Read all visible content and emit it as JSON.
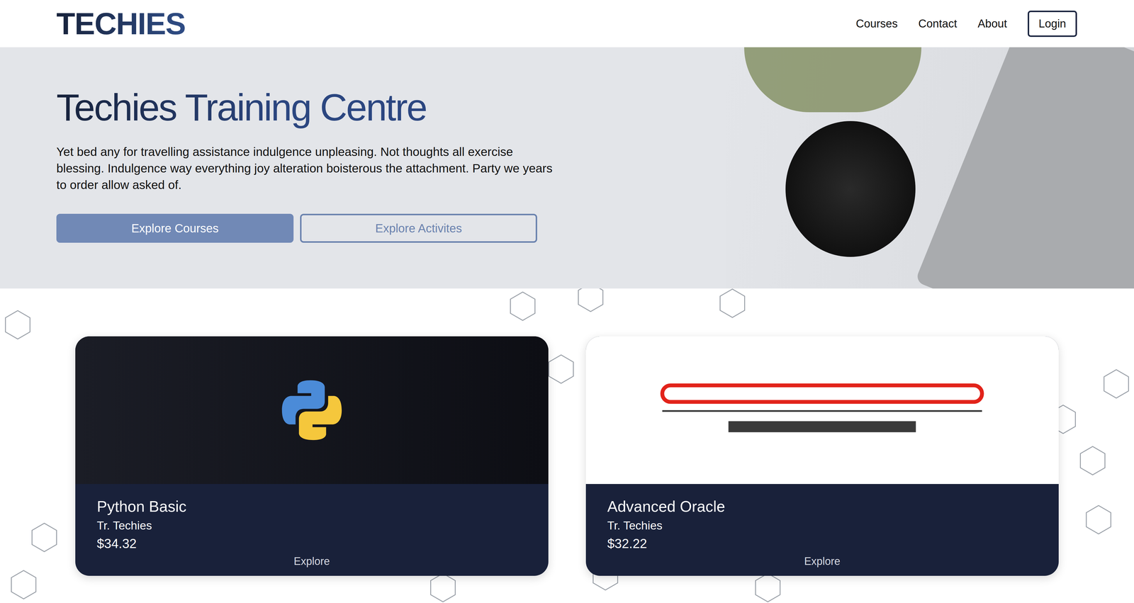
{
  "logo": "TECHIES",
  "nav": [
    {
      "label": "Courses"
    },
    {
      "label": "Contact"
    },
    {
      "label": "About"
    }
  ],
  "login": "Login",
  "hero": {
    "title": "Techies Training Centre",
    "text": "Yet bed any for travelling assistance indulgence unpleasing. Not thoughts all exercise blessing. Indulgence way everything joy alteration boisterous the attachment. Party we years to order allow asked of.",
    "buttons": [
      {
        "label": "Explore Courses",
        "kind": "primary"
      },
      {
        "label": "Explore Activites",
        "kind": "outline"
      }
    ]
  },
  "courses": [
    {
      "title": "Python Basic",
      "trainer": "Tr. Techies",
      "price": "$34.32",
      "action": "Explore",
      "kind": "python"
    },
    {
      "title": "Advanced Oracle",
      "trainer": "Tr. Techies",
      "price": "$32.22",
      "action": "Explore",
      "kind": "oracle"
    }
  ]
}
